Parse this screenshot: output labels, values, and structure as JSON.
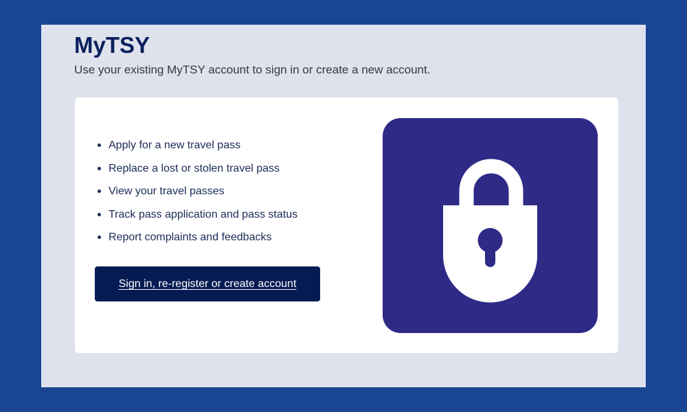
{
  "header": {
    "title": "MyTSY",
    "subtitle": "Use your existing MyTSY account to sign in or create a new account."
  },
  "features": [
    "Apply for a new travel pass",
    "Replace a lost or stolen travel pass",
    "View your travel passes",
    "Track pass application and pass status",
    "Report complaints and feedbacks"
  ],
  "actions": {
    "signin_label": "Sign in, re-register or create account"
  },
  "illustration": {
    "icon": "lock-icon",
    "tile_color": "#2e2a86"
  },
  "colors": {
    "page_background": "#1a4494",
    "panel_background": "#dee2ec",
    "title_color": "#0a1f5c",
    "button_background": "#061b52"
  }
}
